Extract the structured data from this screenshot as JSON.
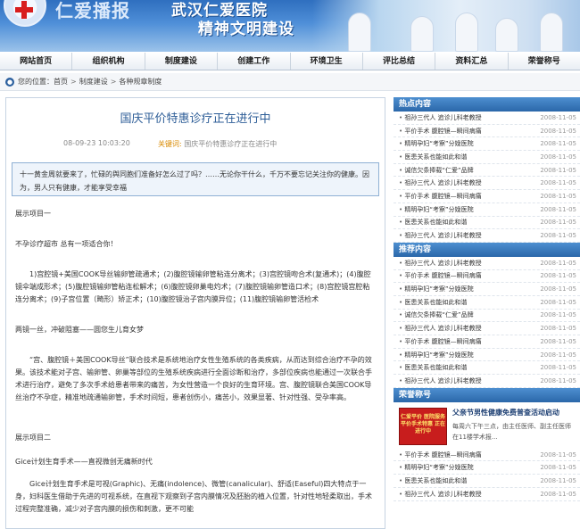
{
  "banner": {
    "site_name": "仁爱播报",
    "slogan_line1": "武汉仁爱医院",
    "slogan_line2": "精神文明建设"
  },
  "nav": {
    "items": [
      {
        "label": "网站首页"
      },
      {
        "label": "组织机构"
      },
      {
        "label": "制度建设"
      },
      {
        "label": "创建工作"
      },
      {
        "label": "环境卫生"
      },
      {
        "label": "评比总结"
      },
      {
        "label": "资料汇总"
      },
      {
        "label": "荣誉称号"
      }
    ]
  },
  "breadcrumb": {
    "prefix": "您的位置：",
    "items": [
      "首页",
      "制度建设",
      "各种规章制度"
    ],
    "sep": ">"
  },
  "article": {
    "title": "国庆平价特惠诊疗正在进行中",
    "date": "08-09-23 10:03:20",
    "keyword_label": "关键词:",
    "keyword_value": "国庆平价特惠诊疗正在进行中",
    "summary": "十一黄金周就要来了，忙碌的舆同胞们准备好怎么过了吗？……无论你干什么，千万不要忘记关注你的健康。因为，男人只有健康，才能享受幸福",
    "paragraphs": [
      "展示项目一",
      "不孕诊疗超市 总有一项适合你！",
      "1)宫腔镜+美国COOK导丝输卵管疏通术；(2)腹腔镜输卵管粘连分离术；(3)宫腔镜吻合术(复通术)；(4)腹腔镜伞端成形术；(5)腹腔镜输卵管粘连松解术；(6)腹腔镜卵巢电灼术；(7)腹腔镜输卵管造口术；(8)宫腔镜宫腔粘连分离术；(9)子宫位置（畸形）矫正术；(10)腹腔镜治子宫内膜异位；(11)腹腔镜输卵管活检术",
      "两镜一丝，冲破阻塞——圆您生儿育女梦",
      "“宫、腹腔镜＋美国COOK导丝”联合技术是系统地治疗女性生殖系统的各类疾病，从而达到综合治疗不孕的效果。该技术能对子宫、输卵管、卵巢等部位的生殖系统疾病进行全面诊断和治疗，多部位疾病也能通过一次联合手术进行治疗，避免了多次手术给患者带来的痛苦，为女性营造一个良好的生育环境。宫、腹腔镜联合美国COOK导丝治疗不孕症，精准地疏通输卵管，手术时间短，患者创伤小，痛苦小，效果显著、针对性强、受孕率高。",
      "展示项目二",
      "Gice计划生育手术——直视微创无痛新时代",
      "Gice计划生育手术是可视(Graphic)、无痛(indolence)、微管(canalicular)、舒适(Easeful)四大特点于一身，妇科医生借助于先进的可视系统，在直视下观察到子宫内膜情况及胚胎的植入位置，针对性地轻柔取出，手术过程完整准确，减少对子宫内膜的损伤和刺激，更不可能"
    ]
  },
  "sidebar": {
    "hot": {
      "title": "热点内容",
      "items": [
        {
          "title": "祖孙三代人 追诊儿科老教授",
          "date": "2008-11-05"
        },
        {
          "title": "平价手术 腹腔镜—瞬间病痛",
          "date": "2008-11-05"
        },
        {
          "title": "精明孕妇“考察”分娩医院",
          "date": "2008-11-05"
        },
        {
          "title": "医患关系也能如此和谐",
          "date": "2008-11-05"
        },
        {
          "title": "诚信欠条捧载“仁爱”品牌",
          "date": "2008-11-05"
        },
        {
          "title": "祖孙三代人 追诊儿科老教授",
          "date": "2008-11-05"
        },
        {
          "title": "平价手术 腹腔镜—瞬间病痛",
          "date": "2008-11-05"
        },
        {
          "title": "精明孕妇“考察”分娩医院",
          "date": "2008-11-05"
        },
        {
          "title": "医患关系也能如此和谐",
          "date": "2008-11-05"
        },
        {
          "title": "祖孙三代人 追诊儿科老教授",
          "date": "2008-11-05"
        }
      ]
    },
    "recommend": {
      "title": "推荐内容",
      "items": [
        {
          "title": "祖孙三代人 追诊儿科老教授",
          "date": "2008-11-05"
        },
        {
          "title": "平价手术 腹腔镜—瞬间病痛",
          "date": "2008-11-05"
        },
        {
          "title": "精明孕妇“考察”分娩医院",
          "date": "2008-11-05"
        },
        {
          "title": "医患关系也能如此和谐",
          "date": "2008-11-05"
        },
        {
          "title": "诚信欠条捧载“仁爱”品牌",
          "date": "2008-11-05"
        },
        {
          "title": "祖孙三代人 追诊儿科老教授",
          "date": "2008-11-05"
        },
        {
          "title": "平价手术 腹腔镜—瞬间病痛",
          "date": "2008-11-05"
        },
        {
          "title": "精明孕妇“考察”分娩医院",
          "date": "2008-11-05"
        },
        {
          "title": "医患关系也能如此和谐",
          "date": "2008-11-05"
        },
        {
          "title": "祖孙三代人 追诊儿科老教授",
          "date": "2008-11-05"
        }
      ]
    },
    "honor": {
      "title": "荣誉称号",
      "promo_image_text": "仁爱平价 医院服务 平价手术特惠 正在进行中",
      "promo_title": "父亲节男性健康免费普查活动启动",
      "promo_desc": "每周六下午三点，由主任医师、副主任医师在11楼学术报...",
      "items": [
        {
          "title": "平价手术 腹腔镜—瞬间病痛",
          "date": "2008-11-05"
        },
        {
          "title": "精明孕妇“考察”分娩医院",
          "date": "2008-11-05"
        },
        {
          "title": "医患关系也能如此和谐",
          "date": "2008-11-05"
        },
        {
          "title": "祖孙三代人 追诊儿科老教授",
          "date": "2008-11-05"
        }
      ]
    }
  }
}
